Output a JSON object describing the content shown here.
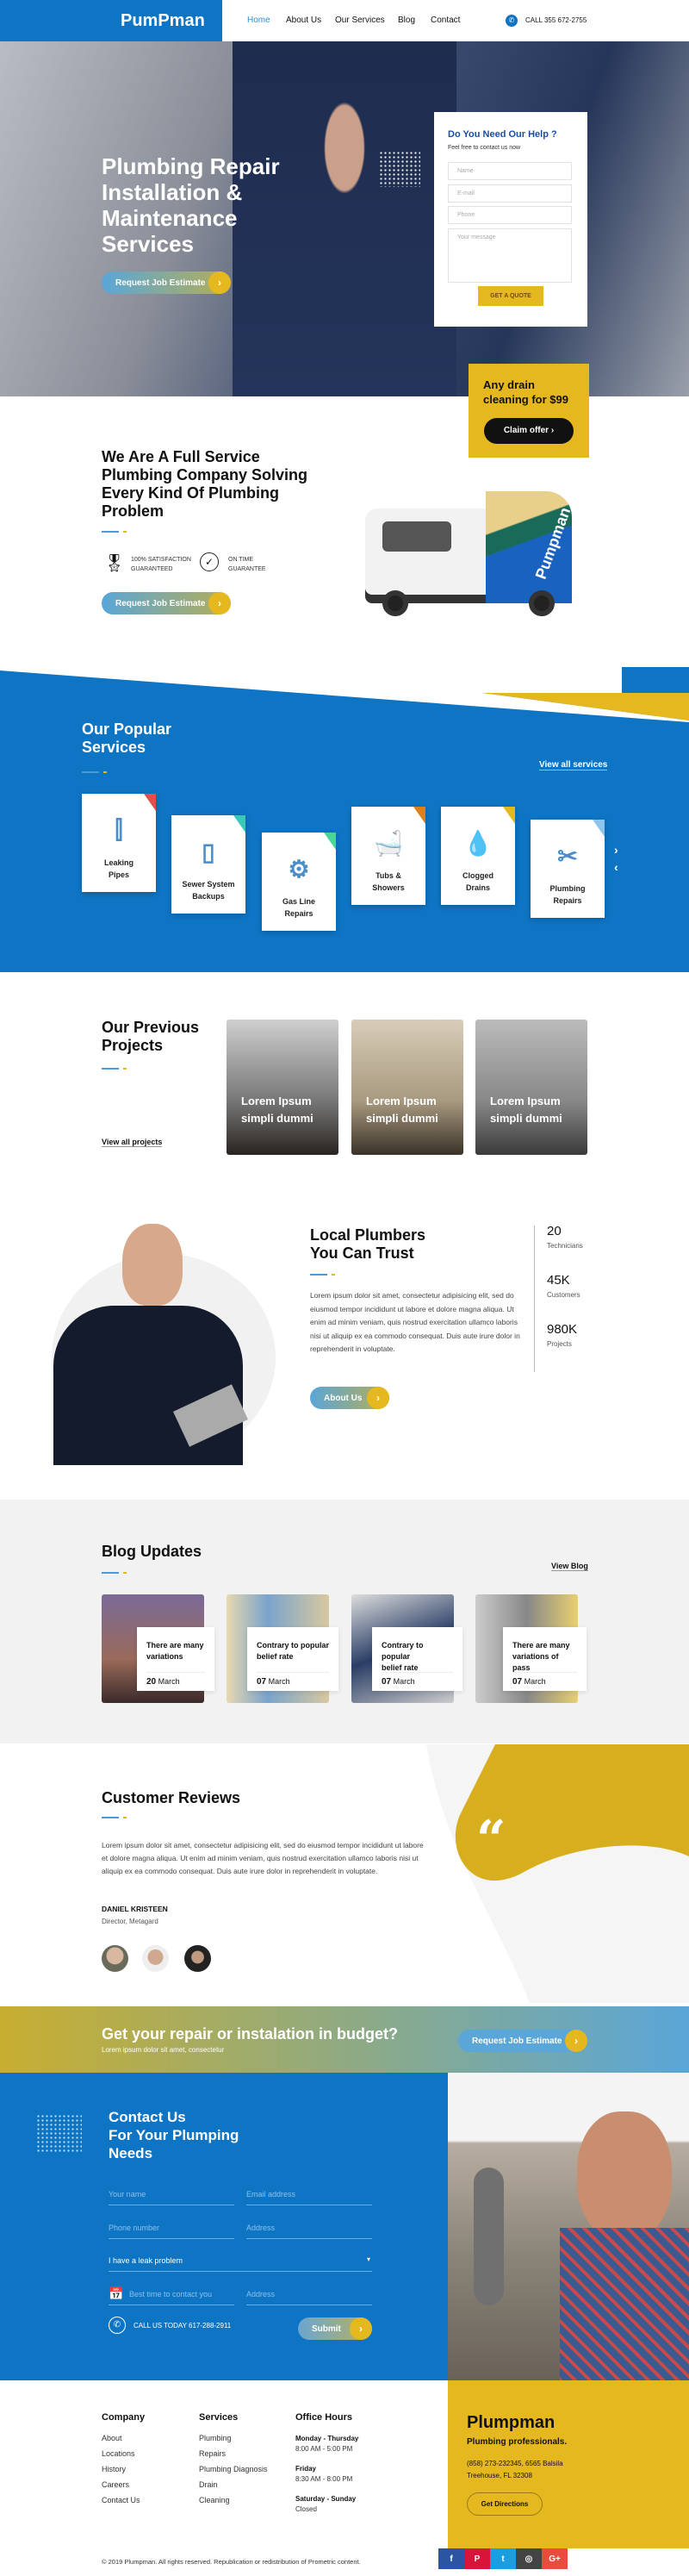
{
  "colors": {
    "primary": "#0e74c4",
    "accent": "#e6b820",
    "dark": "#111111"
  },
  "header": {
    "logo": "PumPman",
    "nav": [
      "Home",
      "About Us",
      "Our Services",
      "Blog",
      "Contact"
    ],
    "active": "Home",
    "phone": "CALL 355 672-2755",
    "phone_icon": "phone-icon"
  },
  "hero": {
    "title_lines": [
      "Plumbing Repair",
      "Installation &",
      "Maintenance",
      "Services"
    ],
    "cta": "Request Job Estimate",
    "form": {
      "title": "Do You Need Our Help ?",
      "subtitle": "Feel free to contact us now",
      "name_ph": "Name",
      "email_ph": "E-mail",
      "phone_ph": "Phone",
      "message_ph": "Your message",
      "submit": "GET A QUOTE"
    }
  },
  "offer": {
    "text_lines": [
      "Any drain",
      "cleaning for $99"
    ],
    "button": "Claim offer"
  },
  "about": {
    "title_lines": [
      "We Are A Full Service",
      "Plumbing Company Solving",
      "Every Kind Of Plumbing",
      "Problem"
    ],
    "badges": [
      {
        "icon": "award-ribbon-icon",
        "line1": "100% SATISFACTION",
        "line2": "GUARANTEED"
      },
      {
        "icon": "check-circle-icon",
        "line1": "ON TIME",
        "line2": "GUARANTEE"
      }
    ],
    "cta": "Request Job Estimate",
    "van_brand": "Pumpman"
  },
  "services": {
    "title_lines": [
      "Our Popular",
      "Services"
    ],
    "view_all": "View all services",
    "items": [
      {
        "l1": "Leaking",
        "l2": "Pipes",
        "icon": "pipe-icon",
        "color": "#e84c4c"
      },
      {
        "l1": "Sewer System",
        "l2": "Backups",
        "icon": "water-tank-icon",
        "color": "#3cc8b4"
      },
      {
        "l1": "Gas Line",
        "l2": "Repairs",
        "icon": "gas-valve-icon",
        "color": "#48d49a"
      },
      {
        "l1": "Tubs &",
        "l2": "Showers",
        "icon": "bathtub-icon",
        "color": "#e0801c"
      },
      {
        "l1": "Clogged",
        "l2": "Drains",
        "icon": "drain-pipe-icon",
        "color": "#e6b820"
      },
      {
        "l1": "Plumbing",
        "l2": "Repairs",
        "icon": "wrench-screwdriver-icon",
        "color": "#8cc4ee"
      }
    ]
  },
  "projects": {
    "title_lines": [
      "Our Previous",
      "Projects"
    ],
    "view_all": "View all projects",
    "items": [
      {
        "l1": "Lorem Ipsum",
        "l2": "simpli dummi"
      },
      {
        "l1": "Lorem Ipsum",
        "l2": "simpli dummi"
      },
      {
        "l1": "Lorem Ipsum",
        "l2": "simpli dummi"
      }
    ]
  },
  "trust": {
    "title_lines": [
      "Local Plumbers",
      "You Can Trust"
    ],
    "text": "Lorem ipsum dolor sit amet, consectetur adipisicing elit, sed do eiusmod tempor incididunt ut labore et dolore magna aliqua. Ut enim ad minim veniam, quis nostrud exercitation ullamco laboris nisi ut aliquip ex ea commodo consequat. Duis aute irure dolor in reprehenderit in voluptate.",
    "cta": "About Us",
    "stats": [
      {
        "value": "20",
        "label": "Technicians"
      },
      {
        "value": "45K",
        "label": "Customers"
      },
      {
        "value": "980K",
        "label": "Projects"
      }
    ]
  },
  "blog": {
    "title": "Blog Updates",
    "view": "View Blog",
    "posts": [
      {
        "l1": "There are many",
        "l2": "variations",
        "day": "20",
        "month": "March"
      },
      {
        "l1": "Contrary to popular",
        "l2": "belief rate",
        "day": "07",
        "month": "March"
      },
      {
        "l1": "Contrary to popular",
        "l2": "belief rate",
        "day": "07",
        "month": "March"
      },
      {
        "l1": "There are many",
        "l2": "variations of pass",
        "day": "07",
        "month": "March"
      }
    ]
  },
  "reviews": {
    "title": "Customer Reviews",
    "text": "Lorem ipsum dolor sit amet, consectetur adipisicing elit, sed do eiusmod tempor incididunt ut labore et dolore magna aliqua. Ut enim ad minim veniam, quis nostrud exercitation ullamco laboris nisi ut aliquip ex ea commodo consequat. Duis aute irure dolor in reprehenderit in voluptate.",
    "name": "DANIEL KRISTEEN",
    "role": "Director, Metagard",
    "quote_icon": "quote-icon"
  },
  "banner": {
    "title": "Get your repair or instalation in budget?",
    "subtitle": "Lorem ipsum dolor sit amet, consectetur",
    "cta": "Request Job Estimate"
  },
  "contact": {
    "title_lines": [
      "Contact Us",
      "For Your Plumping",
      "Needs"
    ],
    "name_ph": "Your name",
    "email_ph": "Email address",
    "phone_ph": "Phone number",
    "address_ph": "Address",
    "select_value": "I have a leak problem",
    "time_ph": "Best time to contact you",
    "address2_ph": "Address",
    "call": "CALL US TODAY 617-288-2911",
    "submit": "Submit"
  },
  "footer": {
    "company": {
      "title": "Company",
      "items": [
        "About",
        "Locations",
        "History",
        "Careers",
        "Contact Us"
      ]
    },
    "services": {
      "title": "Services",
      "items": [
        "Plumbing",
        "Repairs",
        "Plumbing Diagnosis",
        "Drain",
        "Cleaning"
      ]
    },
    "hours": {
      "title": "Office Hours",
      "items": [
        {
          "day": "Monday - Thursday",
          "time": "8:00 AM - 5:00 PM"
        },
        {
          "day": "Friday",
          "time": "8:30 AM - 8:00 PM"
        },
        {
          "day": "Saturday - Sunday",
          "time": "Closed"
        }
      ]
    },
    "brand": {
      "name": "Plumpman",
      "tagline": "Plumbing professionals.",
      "address1": "(858) 273-232345, 6565 Balsila",
      "address2": "Treehouse, FL 32308",
      "button": "Get Directions"
    },
    "copyright": "© 2019 Plumpman. All rights reserved. Republication or redistribution of Prometric content.",
    "social": [
      {
        "icon": "facebook-icon",
        "glyph": "f",
        "color": "#2a55a0"
      },
      {
        "icon": "pinterest-icon",
        "glyph": "P",
        "color": "#d8143a"
      },
      {
        "icon": "twitter-icon",
        "glyph": "t",
        "color": "#1a9ee0"
      },
      {
        "icon": "instagram-icon",
        "glyph": "◎",
        "color": "#444444"
      },
      {
        "icon": "google-plus-icon",
        "glyph": "G+",
        "color": "#e84c3c"
      }
    ]
  }
}
